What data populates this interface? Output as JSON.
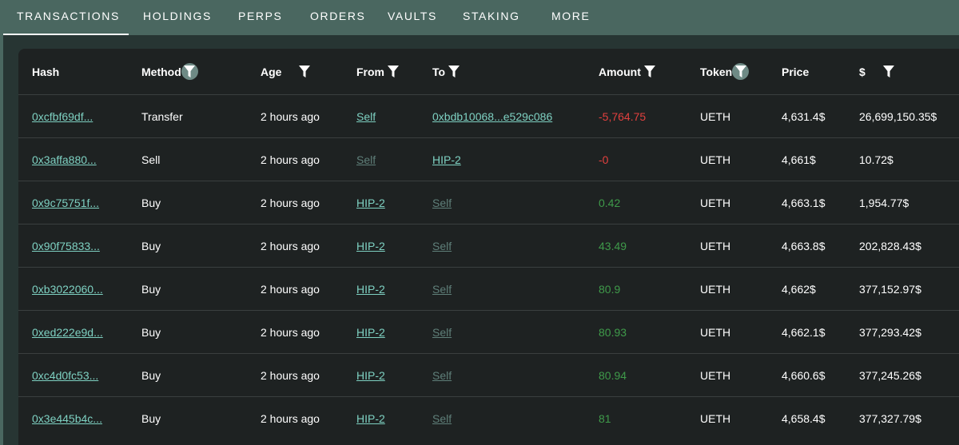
{
  "tabs": [
    {
      "label": "TRANSACTIONS",
      "active": true
    },
    {
      "label": "HOLDINGS",
      "active": false
    },
    {
      "label": "PERPS",
      "active": false
    },
    {
      "label": "ORDERS",
      "active": false
    },
    {
      "label": "VAULTS",
      "active": false
    },
    {
      "label": "STAKING",
      "active": false
    },
    {
      "label": "MORE",
      "active": false
    }
  ],
  "columns": [
    {
      "key": "hash",
      "label": "Hash",
      "filter": "none"
    },
    {
      "key": "method",
      "label": "Method",
      "filter": "circle"
    },
    {
      "key": "age",
      "label": "Age",
      "filter": "plain"
    },
    {
      "key": "from",
      "label": "From",
      "filter": "plain"
    },
    {
      "key": "to",
      "label": "To",
      "filter": "plain"
    },
    {
      "key": "amount",
      "label": "Amount",
      "filter": "plain"
    },
    {
      "key": "token",
      "label": "Token",
      "filter": "circle"
    },
    {
      "key": "price",
      "label": "Price",
      "filter": "none"
    },
    {
      "key": "usd",
      "label": "$",
      "filter": "plain"
    }
  ],
  "rows": [
    {
      "hash": "0xcfbf69df...",
      "method": "Transfer",
      "age": "2 hours ago",
      "from": "Self",
      "from_dim": false,
      "to": "0xbdb10068...e529c086",
      "to_dim": false,
      "amount": "-5,764.75",
      "sign": "neg",
      "token": "UETH",
      "price": "4,631.4$",
      "usd": "26,699,150.35$"
    },
    {
      "hash": "0x3affa880...",
      "method": "Sell",
      "age": "2 hours ago",
      "from": "Self",
      "from_dim": true,
      "to": "HIP-2",
      "to_dim": false,
      "amount": "-0",
      "sign": "neg",
      "token": "UETH",
      "price": "4,661$",
      "usd": "10.72$"
    },
    {
      "hash": "0x9c75751f...",
      "method": "Buy",
      "age": "2 hours ago",
      "from": "HIP-2",
      "from_dim": false,
      "to": "Self",
      "to_dim": true,
      "amount": "0.42",
      "sign": "pos",
      "token": "UETH",
      "price": "4,663.1$",
      "usd": "1,954.77$"
    },
    {
      "hash": "0x90f75833...",
      "method": "Buy",
      "age": "2 hours ago",
      "from": "HIP-2",
      "from_dim": false,
      "to": "Self",
      "to_dim": true,
      "amount": "43.49",
      "sign": "pos",
      "token": "UETH",
      "price": "4,663.8$",
      "usd": "202,828.43$"
    },
    {
      "hash": "0xb3022060...",
      "method": "Buy",
      "age": "2 hours ago",
      "from": "HIP-2",
      "from_dim": false,
      "to": "Self",
      "to_dim": true,
      "amount": "80.9",
      "sign": "pos",
      "token": "UETH",
      "price": "4,662$",
      "usd": "377,152.97$"
    },
    {
      "hash": "0xed222e9d...",
      "method": "Buy",
      "age": "2 hours ago",
      "from": "HIP-2",
      "from_dim": false,
      "to": "Self",
      "to_dim": true,
      "amount": "80.93",
      "sign": "pos",
      "token": "UETH",
      "price": "4,662.1$",
      "usd": "377,293.42$"
    },
    {
      "hash": "0xc4d0fc53...",
      "method": "Buy",
      "age": "2 hours ago",
      "from": "HIP-2",
      "from_dim": false,
      "to": "Self",
      "to_dim": true,
      "amount": "80.94",
      "sign": "pos",
      "token": "UETH",
      "price": "4,660.6$",
      "usd": "377,245.26$"
    },
    {
      "hash": "0x3e445b4c...",
      "method": "Buy",
      "age": "2 hours ago",
      "from": "HIP-2",
      "from_dim": false,
      "to": "Self",
      "to_dim": true,
      "amount": "81",
      "sign": "pos",
      "token": "UETH",
      "price": "4,658.4$",
      "usd": "377,327.79$"
    }
  ],
  "colors": {
    "negative": "#e2403e",
    "positive": "#3f9a4a",
    "link": "#7ed1c2",
    "link_dim": "#5f7f79"
  }
}
